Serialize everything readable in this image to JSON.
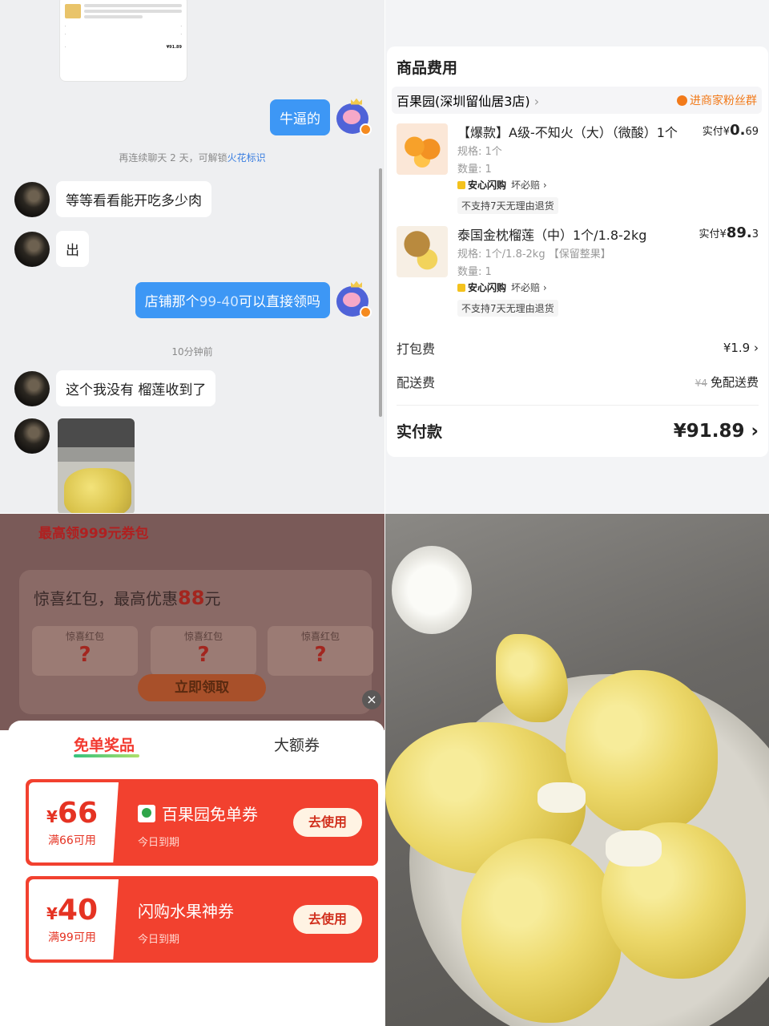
{
  "chat": {
    "messages": [
      {
        "side": "right",
        "text": "牛逼的"
      },
      {
        "type": "system",
        "text": "再连续聊天 2 天，可解锁",
        "link": "火花标识"
      },
      {
        "side": "left",
        "text": "等等看看能开吃多少肉"
      },
      {
        "side": "left",
        "text": "出"
      },
      {
        "side": "right",
        "text_pre": "店铺那个",
        "text_hl": "99-40",
        "text_post": "可以直接领吗"
      },
      {
        "type": "system",
        "text": "10分钟前"
      },
      {
        "side": "left",
        "text": "这个我没有 榴莲收到了"
      }
    ],
    "mini_receipt_total": "¥91.89"
  },
  "order": {
    "section_title": "商品费用",
    "store_name": "百果园(深圳留仙居3店)",
    "store_chevron": "›",
    "join_group": "进商家粉丝群",
    "items": [
      {
        "name": "【爆款】A级-不知火（大）（微酸）1个",
        "price_label": "实付",
        "price_symbol": "¥",
        "price_int": "0.",
        "price_dec": "69",
        "spec": "规格: 1个",
        "qty": "数量: 1",
        "guarantee": "安心闪购",
        "guarantee_note": "坏必赔 ›",
        "no_return": "不支持7天无理由退货"
      },
      {
        "name": "泰国金枕榴莲（中）1个/1.8-2kg",
        "price_label": "实付",
        "price_symbol": "¥",
        "price_int": "89.",
        "price_dec": "3",
        "spec": "规格: 1个/1.8-2kg 【保留整果】",
        "qty": "数量: 1",
        "guarantee": "安心闪购",
        "guarantee_note": "坏必赔 ›",
        "no_return": "不支持7天无理由退货"
      }
    ],
    "packing_label": "打包费",
    "packing_value": "¥1.9 ›",
    "delivery_label": "配送费",
    "delivery_old": "¥4",
    "delivery_value": "免配送费",
    "total_label": "实付款",
    "total_value": "¥91.89 ›"
  },
  "coupon_popup": {
    "promo_header": "最高领999元券包",
    "promo_title_pre": "惊喜红包，最高优惠",
    "promo_title_amount": "88",
    "promo_title_unit": "元",
    "slot_label": "惊喜红包",
    "slot_mark": "?",
    "claim_button": "立即领取",
    "close": "×",
    "tab_free": "免单奖品",
    "tab_big": "大额券",
    "coupons": [
      {
        "symbol": "¥",
        "amount": "66",
        "condition": "满66可用",
        "title": "百果园免单券",
        "expiry": "今日到期",
        "button": "去使用"
      },
      {
        "symbol": "¥",
        "amount": "40",
        "condition": "满99可用",
        "title": "闪购水果神券",
        "expiry": "今日到期",
        "button": "去使用"
      }
    ]
  }
}
